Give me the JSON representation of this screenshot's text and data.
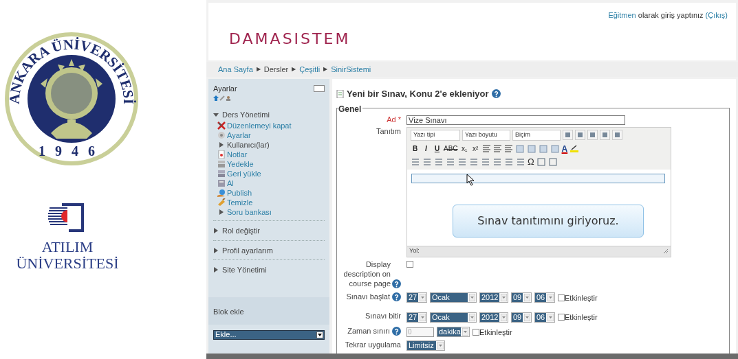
{
  "logos": {
    "ankara": {
      "arc_text": "ANKARA ÜNİVERSİTESİ",
      "year": "1946"
    },
    "atilim": {
      "line_1": "ATILIM",
      "line_2": "ÜNİVERSİTESİ"
    }
  },
  "header": {
    "site_name": "DAMASISTEM",
    "login": {
      "role_link": "Eğitmen",
      "text": "olarak giriş yaptınız",
      "logout_link": "(Çıkış)"
    }
  },
  "breadcrumb": {
    "separator": "▶",
    "items": [
      {
        "label": "Ana Sayfa",
        "link": true
      },
      {
        "label": "Dersler",
        "link": false
      },
      {
        "label": "Çeşitli",
        "link": true
      },
      {
        "label": "SinirSistemi",
        "link": true
      }
    ]
  },
  "sidebar": {
    "title": "Ayarlar",
    "sections": [
      {
        "label": "Ders Yönetimi",
        "expanded": true,
        "children": [
          {
            "label": "Düzenlemeyi kapat",
            "kind": "tools",
            "link": true
          },
          {
            "label": "Ayarlar",
            "kind": "settings",
            "link": true
          },
          {
            "label": "Kullanıcı(lar)",
            "kind": "folder",
            "link": false
          },
          {
            "label": "Notlar",
            "kind": "grades",
            "link": true
          },
          {
            "label": "Yedekle",
            "kind": "backup",
            "link": true
          },
          {
            "label": "Geri yükle",
            "kind": "restore",
            "link": true
          },
          {
            "label": "Al",
            "kind": "import",
            "link": true
          },
          {
            "label": "Publish",
            "kind": "publish",
            "link": true
          },
          {
            "label": "Temizle",
            "kind": "clean",
            "link": true
          },
          {
            "label": "Soru bankası",
            "kind": "folder",
            "link": true
          }
        ]
      },
      {
        "label": "Rol değiştir",
        "expanded": false
      },
      {
        "label": "Profil ayarlarım",
        "expanded": false
      },
      {
        "label": "Site Yönetimi",
        "expanded": false
      }
    ],
    "block": {
      "title": "Blok ekle",
      "select": "Ekle..."
    }
  },
  "main": {
    "title": "Yeni bir Sınav, Konu 2'e ekleniyor",
    "legend": "Genel",
    "fields": [
      {
        "kind": "text",
        "label": "Ad",
        "required": "*",
        "value": "Vize Sınavı"
      },
      {
        "kind": "editor",
        "label": "Tanıtım",
        "selects": [
          "Yazı tipi",
          "Yazı boyutu",
          "Biçim"
        ],
        "text_buttons": [
          "B",
          "I",
          "U",
          "ABC",
          "x₁",
          "x²"
        ],
        "font_color": "A",
        "special_char": "Ω",
        "path_label": "Yol:"
      },
      {
        "kind": "checkbox",
        "label": "Display description on course page",
        "help": true,
        "checked": false
      },
      {
        "kind": "datetime",
        "label": "Sınavı başlat",
        "help": true,
        "parts": [
          "27",
          "Ocak",
          "2012",
          "09",
          "06"
        ],
        "enable_label": "Etkinleştir",
        "enabled": false
      },
      {
        "kind": "datetime",
        "label": "Sınavı bitir",
        "help": false,
        "parts": [
          "27",
          "Ocak",
          "2012",
          "09",
          "06"
        ],
        "enable_label": "Etkinleştir",
        "enabled": false
      },
      {
        "kind": "duration",
        "label": "Zaman sınırı",
        "help": true,
        "value": "0",
        "disabled": true,
        "unit": "dakika",
        "enable_label": "Etkinleştir",
        "enabled": false
      },
      {
        "kind": "select",
        "label": "Tekrar uygulama",
        "help": false,
        "value": "Limitsiz"
      }
    ]
  },
  "callout": "Sınav tanıtımını giriyoruz."
}
